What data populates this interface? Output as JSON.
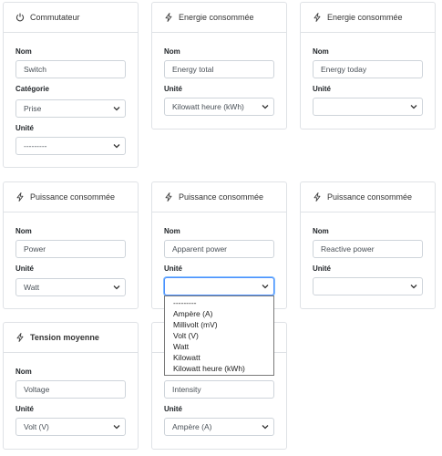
{
  "colors": {
    "border": "#dfe2e6",
    "focus": "#4d90fe",
    "text": "#212529"
  },
  "cards": [
    {
      "title": "Commutateur",
      "icon": "power-icon",
      "nom_label": "Nom",
      "nom_value": "Switch",
      "categorie_label": "Catégorie",
      "categorie_value": "Prise",
      "unite_label": "Unité",
      "unite_value": "---------"
    },
    {
      "title": "Energie consommée",
      "icon": "lightning-icon",
      "nom_label": "Nom",
      "nom_value": "Energy total",
      "unite_label": "Unité",
      "unite_value": "Kilowatt heure (kWh)"
    },
    {
      "title": "Energie consommée",
      "icon": "lightning-icon",
      "nom_label": "Nom",
      "nom_value": "Energy today",
      "unite_label": "Unité",
      "unite_value": ""
    },
    {
      "title": "Puissance consommée",
      "icon": "lightning-icon",
      "nom_label": "Nom",
      "nom_value": "Power",
      "unite_label": "Unité",
      "unite_value": "Watt"
    },
    {
      "title": "Puissance consommée",
      "icon": "lightning-icon",
      "nom_label": "Nom",
      "nom_value": "Apparent power",
      "unite_label": "Unité",
      "unite_value": ""
    },
    {
      "title": "Puissance consommée",
      "icon": "lightning-icon",
      "nom_label": "Nom",
      "nom_value": "Reactive power",
      "unite_label": "Unité",
      "unite_value": ""
    },
    {
      "title": "Tension moyenne",
      "icon": "lightning-icon",
      "nom_label": "Nom",
      "nom_value": "Voltage",
      "unite_label": "Unité",
      "unite_value": "Volt (V)"
    },
    {
      "title": "",
      "nom_value": "Intensity",
      "unite_label": "Unité",
      "unite_value": "Ampère (A)"
    }
  ],
  "dropdown_options": [
    "---------",
    "Ampère (A)",
    "Millivolt (mV)",
    "Volt (V)",
    "Watt",
    "Kilowatt",
    "Kilowatt heure (kWh)"
  ]
}
